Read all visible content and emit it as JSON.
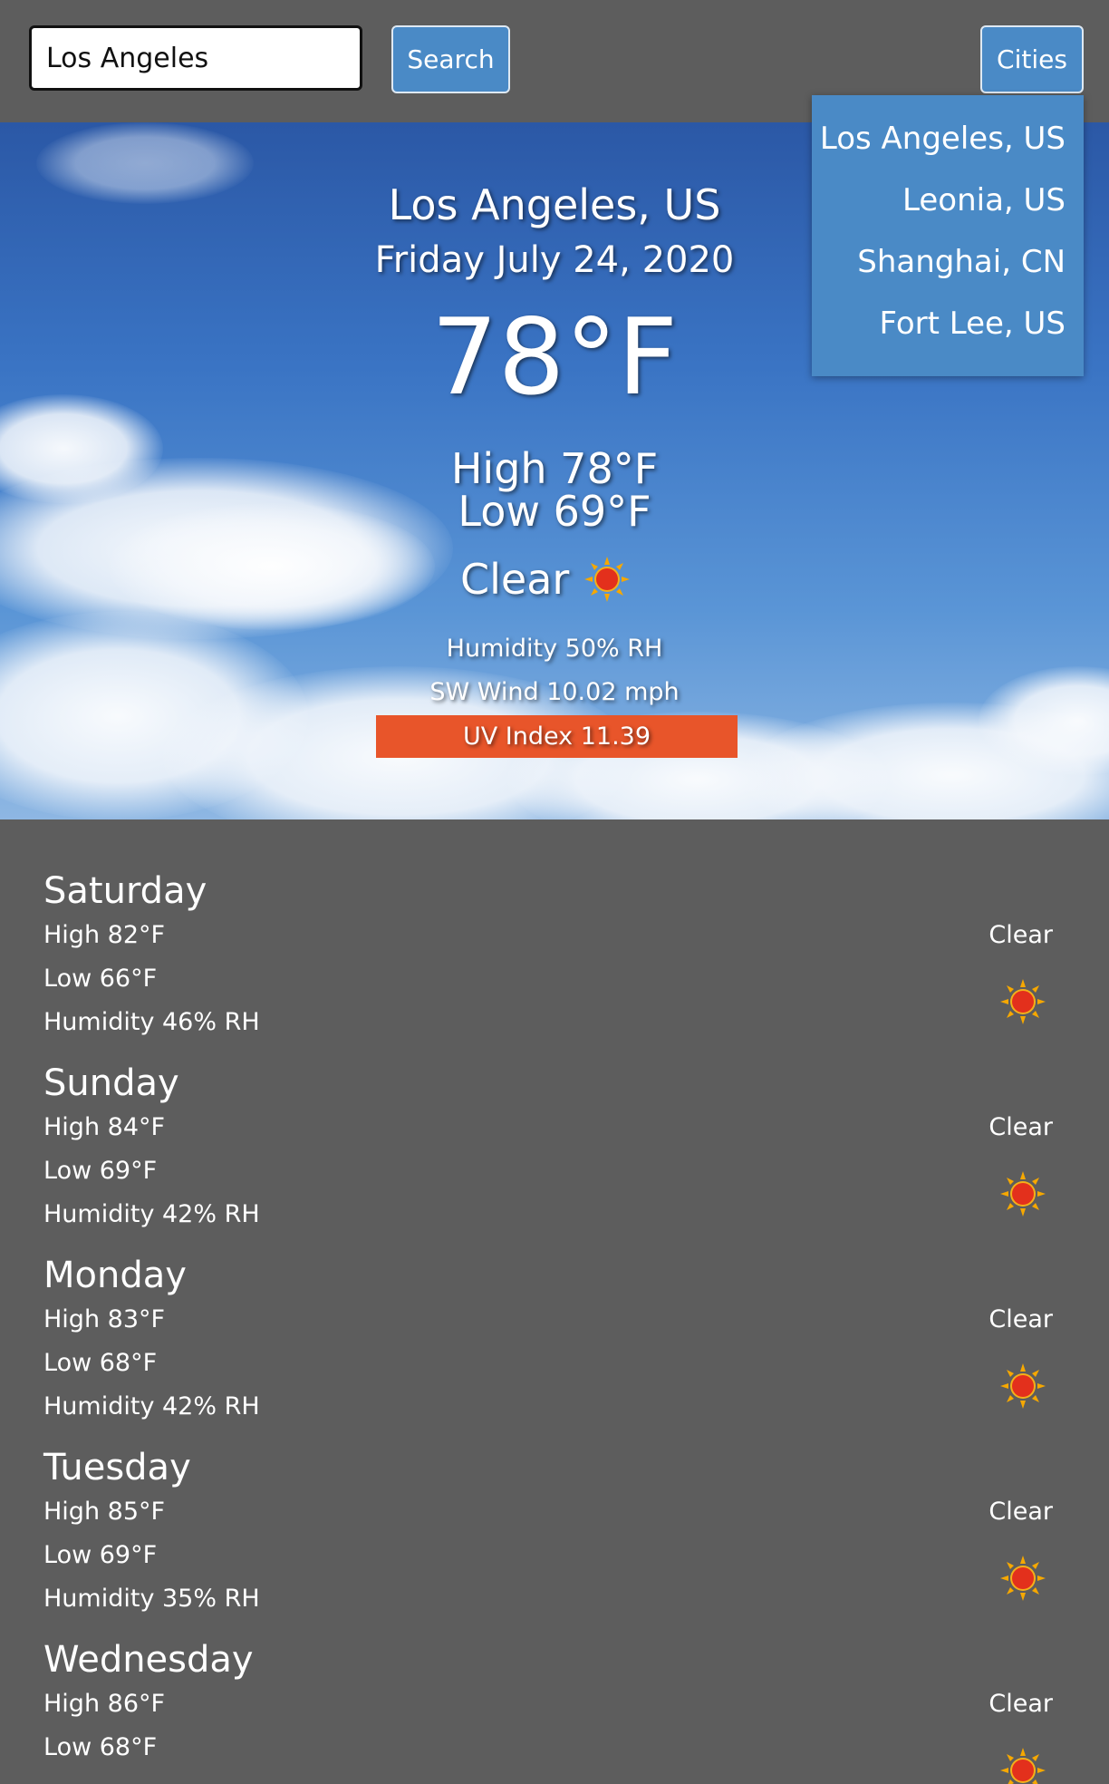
{
  "search": {
    "value": "Los Angeles",
    "button_label": "Search"
  },
  "cities_button_label": "Cities",
  "cities_dropdown": [
    "Los Angeles, US",
    "Leonia, US",
    "Shanghai, CN",
    "Fort Lee, US"
  ],
  "current": {
    "city": "Los Angeles, US",
    "date": "Friday July 24, 2020",
    "temperature": "78°F",
    "high": "High 78°F",
    "low": "Low 69°F",
    "condition": "Clear",
    "condition_icon": "sun-icon",
    "humidity": "Humidity 50% RH",
    "wind": "SW Wind 10.02 mph",
    "uv_index": "UV Index 11.39",
    "uv_color": "#e8552a"
  },
  "forecast": [
    {
      "day": "Saturday",
      "high": "High 82°F",
      "low": "Low 66°F",
      "humidity": "Humidity 46% RH",
      "condition": "Clear"
    },
    {
      "day": "Sunday",
      "high": "High 84°F",
      "low": "Low 69°F",
      "humidity": "Humidity 42% RH",
      "condition": "Clear"
    },
    {
      "day": "Monday",
      "high": "High 83°F",
      "low": "Low 68°F",
      "humidity": "Humidity 42% RH",
      "condition": "Clear"
    },
    {
      "day": "Tuesday",
      "high": "High 85°F",
      "low": "Low 69°F",
      "humidity": "Humidity 35% RH",
      "condition": "Clear"
    },
    {
      "day": "Wednesday",
      "high": "High 86°F",
      "low": "Low 68°F",
      "humidity": "",
      "condition": "Clear"
    }
  ],
  "colors": {
    "background": "#5d5d5d",
    "accent": "#4a8ac6",
    "uv_high": "#e8552a"
  }
}
